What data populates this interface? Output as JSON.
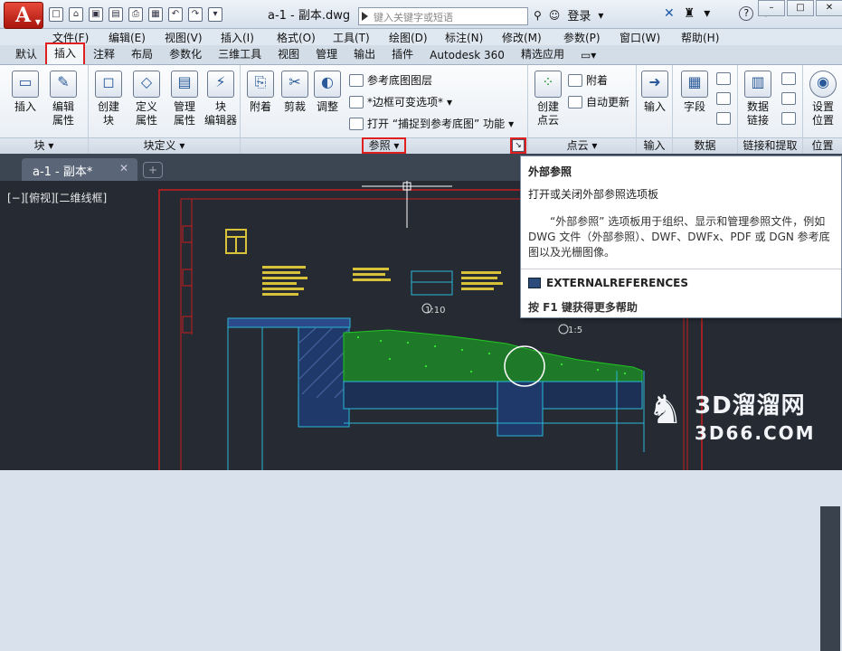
{
  "quick_access": {
    "doc_title": "a-1 - 副本.dwg",
    "search_placeholder": "键入关键字或短语",
    "login_label": "登录",
    "help_icon": "question-icon"
  },
  "menu": {
    "items": [
      "文件(F)",
      "编辑(E)",
      "视图(V)",
      "插入(I)",
      "格式(O)",
      "工具(T)",
      "绘图(D)",
      "标注(N)",
      "修改(M)",
      "参数(P)",
      "窗口(W)",
      "帮助(H)"
    ]
  },
  "ribbon_tabs": {
    "items": [
      "默认",
      "插入",
      "注释",
      "布局",
      "参数化",
      "三维工具",
      "视图",
      "管理",
      "输出",
      "插件",
      "Autodesk 360",
      "精选应用"
    ],
    "active": "插入"
  },
  "panels": {
    "block": {
      "title": "块",
      "insert": "插入",
      "edit_attr_1": "编辑",
      "edit_attr_2": "属性"
    },
    "block_def": {
      "title": "块定义",
      "create_1": "创建",
      "create_2": "块",
      "define_1": "定义",
      "define_2": "属性",
      "manage_1": "管理",
      "manage_2": "属性",
      "editor_1": "块",
      "editor_2": "编辑器"
    },
    "reference": {
      "title": "参照",
      "attach": "附着",
      "clip": "剪裁",
      "adjust": "调整",
      "underlay_layers": "参考底图图层",
      "frame_variable": "*边框可变选项*",
      "snap_underlay": "打开 “捕捉到参考底图” 功能"
    },
    "point_cloud": {
      "title": "点云",
      "create_1": "创建",
      "create_2": "点云",
      "attach": "附着",
      "auto_update": "自动更新"
    },
    "import": {
      "title": "输入",
      "label": "输入"
    },
    "data": {
      "title": "数据",
      "field": "字段"
    },
    "linking": {
      "title": "链接和提取",
      "data_link_1": "数据",
      "data_link_2": "链接"
    },
    "location": {
      "title": "位置",
      "set_1": "设置",
      "set_2": "位置"
    }
  },
  "doc_tabs": {
    "active_tab": "a-1 - 副本*",
    "close_icon": "close-icon"
  },
  "canvas": {
    "viewport_label": "[−][俯视][二维线框]",
    "annotations": [
      "1:10",
      "1:5"
    ]
  },
  "tooltip": {
    "title": "外部参照",
    "short_desc": "打开或关闭外部参照选项板",
    "long_desc": "“外部参照” 选项板用于组织、显示和管理参照文件，例如 DWG 文件（外部参照）、DWF、DWFx、PDF 或 DGN 参考底图以及光栅图像。",
    "command": "EXTERNALREFERENCES",
    "help_hint": "按 F1 键获得更多帮助"
  },
  "watermark": {
    "line1": "3D溜溜网",
    "line2": "3D66.COM"
  },
  "colors": {
    "highlight": "#e02020",
    "canvas_bg": "#252a33",
    "hatch_green": "#22c422",
    "frame_red": "#c81e1e",
    "cad_yellow": "#d8c23a",
    "cad_cyan": "#2ab8d8"
  }
}
